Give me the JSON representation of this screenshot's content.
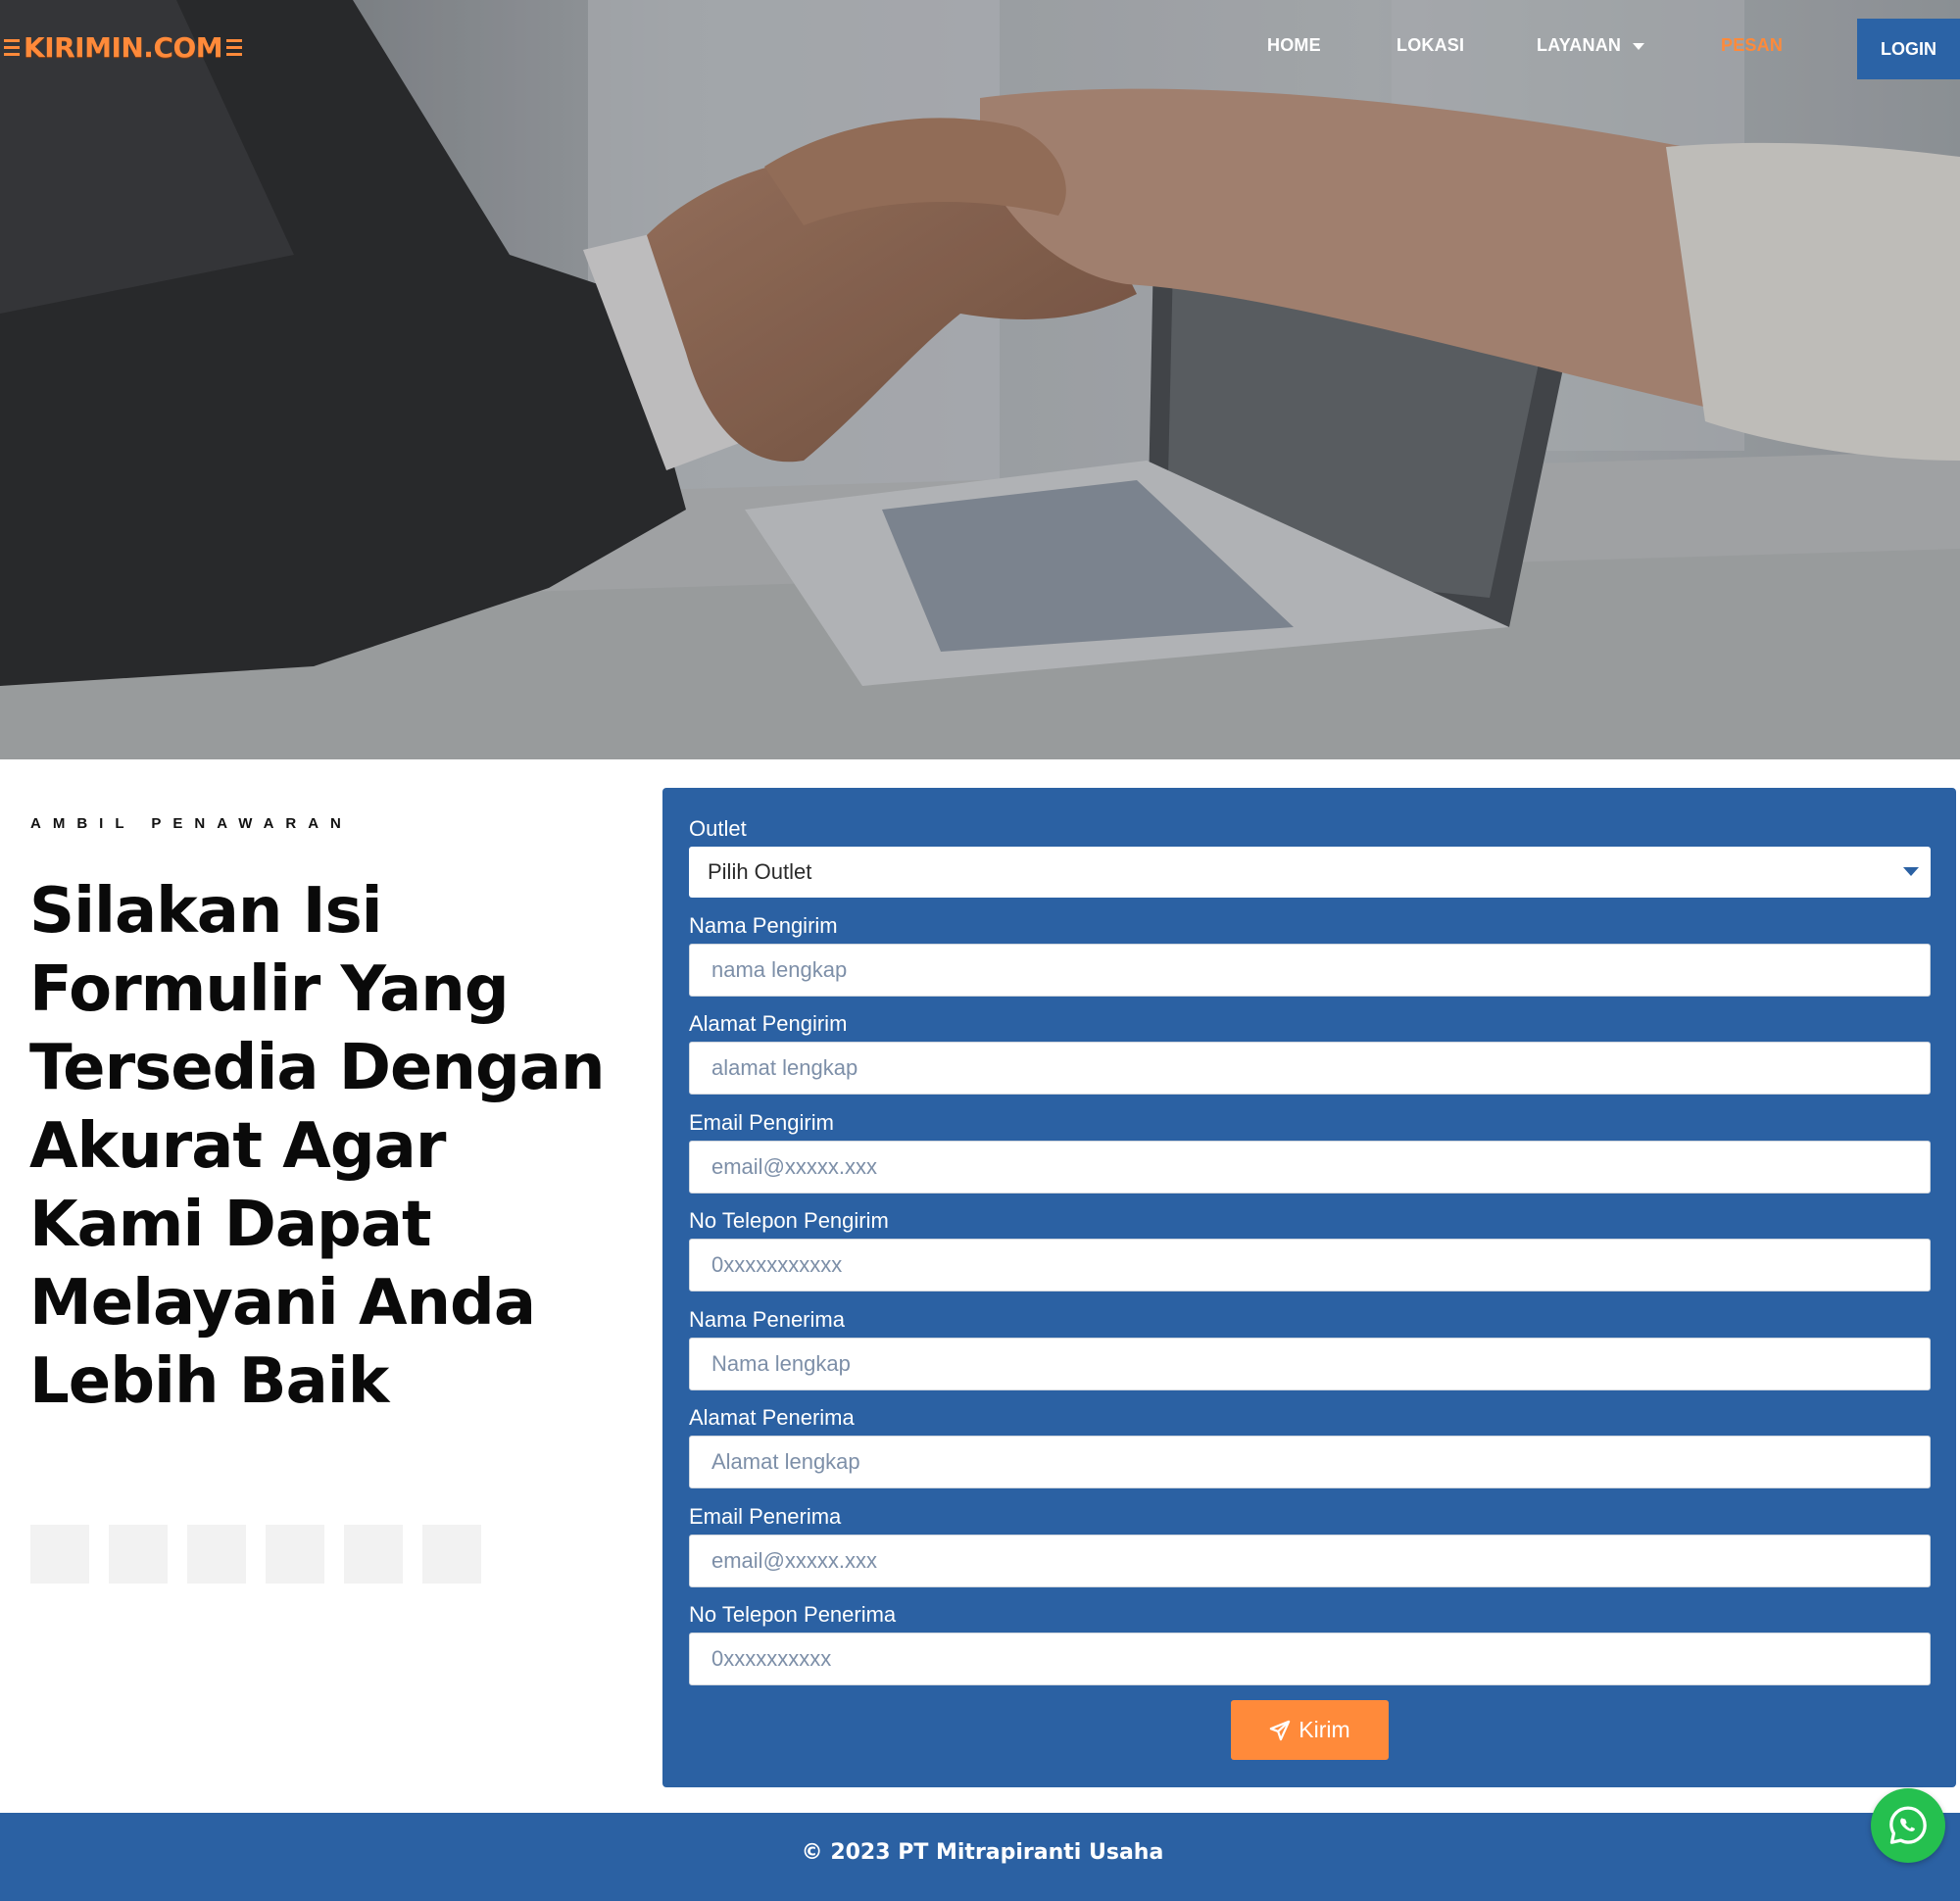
{
  "brand": {
    "logo_text": "KIRIMIN.COM",
    "accent": "#ff8a3a",
    "primary": "#2b61a3"
  },
  "nav": {
    "items": [
      {
        "label": "HOME"
      },
      {
        "label": "LOKASI"
      },
      {
        "label": "LAYANAN"
      },
      {
        "label": "PESAN"
      }
    ],
    "login_label": "LOGIN"
  },
  "hero": {
    "image": "business-handshake-over-laptop"
  },
  "intro": {
    "eyebrow": "AMBIL PENAWARAN",
    "headline": "Silakan Isi Formulir Yang Tersedia Dengan Akurat Agar Kami Dapat Melayani Anda Lebih Baik"
  },
  "form": {
    "outlet": {
      "label": "Outlet",
      "value": "Pilih Outlet"
    },
    "fields": [
      {
        "label": "Nama Pengirim",
        "placeholder": "nama lengkap"
      },
      {
        "label": "Alamat Pengirim",
        "placeholder": "alamat lengkap"
      },
      {
        "label": "Email Pengirim",
        "placeholder": "email@xxxxx.xxx"
      },
      {
        "label": "No Telepon Pengirim",
        "placeholder": "0xxxxxxxxxxx"
      },
      {
        "label": "Nama Penerima",
        "placeholder": "Nama lengkap"
      },
      {
        "label": "Alamat Penerima",
        "placeholder": "Alamat lengkap"
      },
      {
        "label": "Email Penerima",
        "placeholder": "email@xxxxx.xxx"
      },
      {
        "label": "No Telepon Penerima",
        "placeholder": "0xxxxxxxxxx"
      }
    ],
    "submit_label": "Kirim",
    "submit_icon": "paper-plane-icon"
  },
  "footer": {
    "copyright": "© 2023 PT Mitrapiranti Usaha"
  },
  "whatsapp": {
    "icon": "whatsapp-icon"
  }
}
